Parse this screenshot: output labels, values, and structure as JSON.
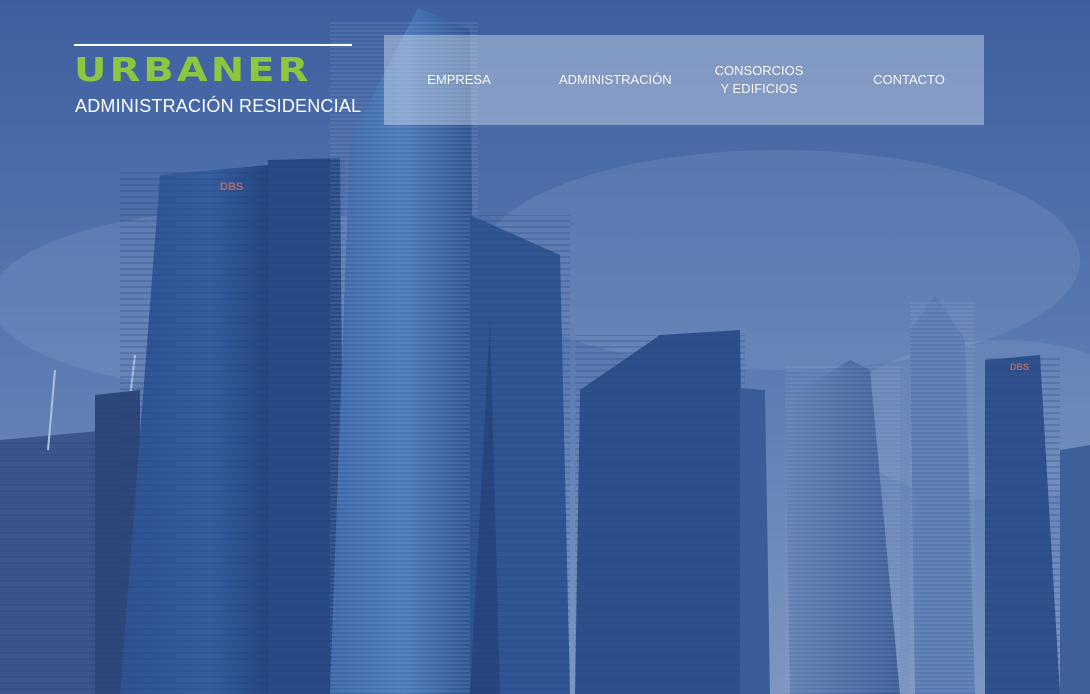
{
  "brand": {
    "name": "URBANER",
    "tagline": "ADMINISTRACIÓN RESIDENCIAL",
    "accent_color": "#8dc63f"
  },
  "nav": {
    "items": [
      {
        "label": "EMPRESA"
      },
      {
        "label": "ADMINISTRACIÓN"
      },
      {
        "label": "CONSORCIOS Y EDIFICIOS"
      },
      {
        "label": "CONTACTO"
      }
    ]
  },
  "hero": {
    "sign_left": "DBS",
    "sign_right": "DBS",
    "tint_color": "#3f63a8"
  }
}
